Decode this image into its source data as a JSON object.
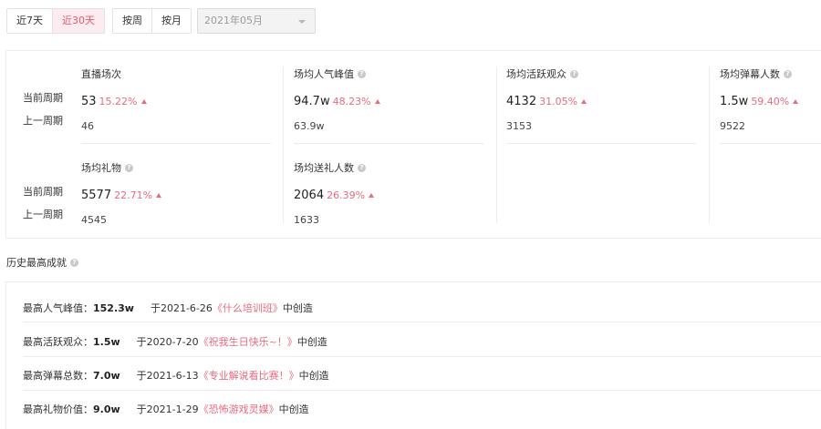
{
  "range_tabs": [
    {
      "label": "近7天",
      "active": false
    },
    {
      "label": "近30天",
      "active": true
    }
  ],
  "period_tabs": [
    {
      "label": "按周",
      "active": false
    },
    {
      "label": "按月",
      "active": false
    }
  ],
  "month_select": {
    "value": "2021年05月"
  },
  "row_labels": {
    "current": "当前周期",
    "previous": "上一周期"
  },
  "metrics": [
    {
      "title": "直播场次",
      "help": false,
      "current": "53",
      "change": "15.22%",
      "previous": "46"
    },
    {
      "title": "场均人气峰值",
      "help": true,
      "current": "94.7w",
      "change": "48.23%",
      "previous": "63.9w"
    },
    {
      "title": "场均活跃观众",
      "help": true,
      "current": "4132",
      "change": "31.05%",
      "previous": "3153"
    },
    {
      "title": "场均弹幕人数",
      "help": true,
      "current": "1.5w",
      "change": "59.40%",
      "previous": "9522"
    },
    {
      "title": "场均礼物",
      "help": true,
      "current": "5577",
      "change": "22.71%",
      "previous": "4545"
    },
    {
      "title": "场均送礼人数",
      "help": true,
      "current": "2064",
      "change": "26.39%",
      "previous": "1633"
    }
  ],
  "achievements": {
    "title": "历史最高成就",
    "items": [
      {
        "label": "最高人气峰值：",
        "value": "152.3w",
        "date_text": "于2021-6-26",
        "show": "《什么培训班》",
        "suffix": "中创造"
      },
      {
        "label": "最高活跃观众：",
        "value": "1.5w",
        "date_text": "于2020-7-20",
        "show": "《祝我生日快乐~！》",
        "suffix": "中创造"
      },
      {
        "label": "最高弹幕总数：",
        "value": "7.0w",
        "date_text": "于2021-6-13",
        "show": "《专业解说看比赛！》",
        "suffix": "中创造"
      },
      {
        "label": "最高礼物价值：",
        "value": "9.0w",
        "date_text": "于2021-1-29",
        "show": "《恐怖游戏灵媒》",
        "suffix": "中创造"
      }
    ]
  },
  "colors": {
    "accent": "#ec6a7f",
    "active_bg": "#fdecef",
    "border": "#ececec"
  }
}
